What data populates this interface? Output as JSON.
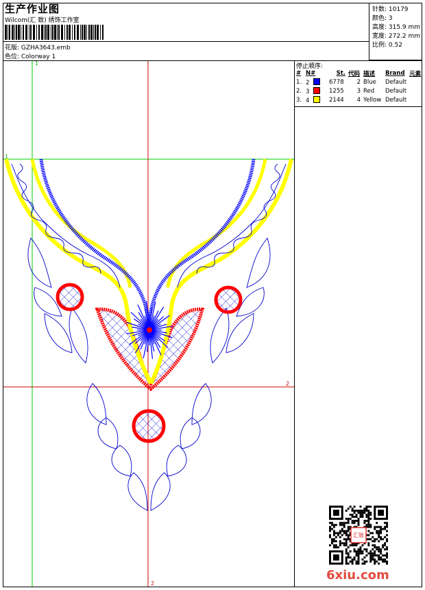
{
  "header": {
    "title": "生产作业图",
    "studio": "Wilcom(汇 致) 绣饰工作室",
    "design_label": "花版: GZHA3643.emb",
    "colorway_label": "色位: Colorway 1"
  },
  "info": {
    "stitches": "针数: 10179",
    "colors": "颜色: 3",
    "height": "高度: 315.9 mm",
    "width": "宽度: 272.2 mm",
    "scale": "比例: 0.52"
  },
  "stop_sequence": {
    "title": "停止顺序:",
    "headers": [
      "#",
      "N#",
      "St.",
      "代码",
      "描述",
      "Brand",
      "元素"
    ],
    "rows": [
      {
        "num": "1.",
        "n": "2",
        "color": "#0000ff",
        "st": "6778",
        "code": "2",
        "desc": "Blue",
        "brand": "Default"
      },
      {
        "num": "2.",
        "n": "3",
        "color": "#ff0000",
        "st": "1255",
        "code": "3",
        "desc": "Red",
        "brand": "Default"
      },
      {
        "num": "3.",
        "n": "4",
        "color": "#ffff00",
        "st": "2144",
        "code": "4",
        "desc": "Yellow",
        "brand": "Default"
      }
    ]
  },
  "guides": {
    "v1": "1",
    "h1": "1",
    "h2": "2",
    "v2": "2"
  },
  "watermark": {
    "site": "6xiu.com",
    "seal": "汇致"
  }
}
